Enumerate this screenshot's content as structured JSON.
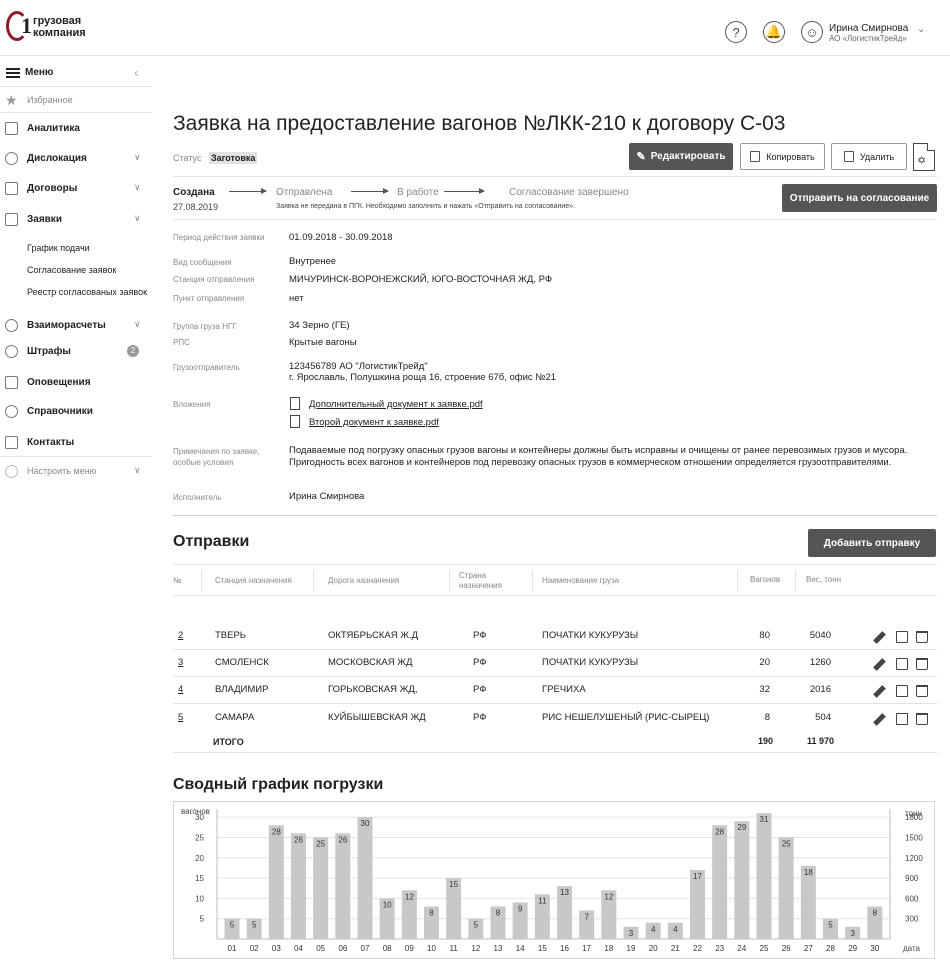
{
  "header": {
    "logo_line1": "грузовая",
    "logo_line2": "компания",
    "user_name": "Ирина Смирнова",
    "user_org": "АО «ЛогистикТрейд»"
  },
  "sidebar": {
    "menu_label": "Меню",
    "favorites": "Избранное",
    "items": [
      {
        "label": "Аналитика"
      },
      {
        "label": "Дислокация"
      },
      {
        "label": "Договоры"
      },
      {
        "label": "Заявки"
      },
      {
        "label": "Взаиморасчеты"
      },
      {
        "label": "Штрафы",
        "badge": "2"
      },
      {
        "label": "Оповещения"
      },
      {
        "label": "Справочники"
      },
      {
        "label": "Контакты"
      }
    ],
    "subitems": [
      "График подачи",
      "Согласование заявок",
      "Реестр согласованых заявок"
    ],
    "configure": "Настроить меню"
  },
  "page": {
    "title": "Заявка на предоставление вагонов №ЛКК-210 к договору С-03",
    "status_label": "Статус",
    "status_value": "Заготовка",
    "buttons": {
      "edit": "Редактировать",
      "copy": "Копировать",
      "delete": "Удалить",
      "send": "Отправить на согласование",
      "add_shipment": "Добавить отправку"
    },
    "steps": [
      "Создана",
      "Отправлена",
      "В работе",
      "Согласование завершено"
    ],
    "created_date": "27.08.2019",
    "step_note": "Заявка не передана в ПГК. Необходимо заполнить и нажать «Отправить на согласование».",
    "fields": {
      "period_label": "Период действия заявки",
      "period_value": "01.09.2018 - 30.09.2018",
      "kind_label": "Вид сообщения",
      "kind_value": "Внутренее",
      "station_label": "Станция отправления",
      "station_value": "МИЧУРИНСК-ВОРОНЕЖСКИЙ, ЮГО-ВОСТОЧНАЯ ЖД, РФ",
      "point_label": "Пункт отправления",
      "point_value": "нет",
      "cargo_label": "Группа груза  НГГ",
      "cargo_value": "34 Зерно (ГЕ)",
      "rps_label": "РПС",
      "rps_value": "Крытые вагоны",
      "shipper_label": "Грузоотправитель",
      "shipper_value1": "123456789  АО \"ЛогистикТрейд\"",
      "shipper_value2": "г. Ярославль, Полушкина роща 16, строение 67б, офис №21",
      "attach_label": "Вложения",
      "attach1": "Дополнительный документ к заявке.pdf",
      "attach2": "Второй документ к заявке.pdf",
      "notes_label1": "Примечания по заявке,",
      "notes_label2": "особые условия",
      "notes_value1": "Подаваемые под погрузку опасных грузов вагоны и контейнеры должны быть исправны и очищены от ранее перевозимых грузов и мусора.",
      "notes_value2": "Пригодность всех вагонов и контейнеров под перевозку опасных грузов в коммерческом отношении определяется грузоотправителями.",
      "executor_label": "Исполнитель",
      "executor_value": "Ирина Смирнова"
    }
  },
  "shipments": {
    "title": "Отправки",
    "headers": {
      "num": "№",
      "station": "Станция назначения",
      "road": "Дорога  назначения",
      "country1": "Страна",
      "country2": "назначения",
      "cargo": "Наименование груза",
      "wagons": "Вагонов",
      "weight": "Вес, тонн"
    },
    "rows": [
      {
        "num": "2",
        "station": "ТВЕРЬ",
        "road": "ОКТЯБРЬСКАЯ Ж.Д",
        "country": "РФ",
        "cargo": "ПОЧАТКИ КУКУРУЗЫ",
        "wagons": "80",
        "weight": "5040"
      },
      {
        "num": "3",
        "station": "СМОЛЕНСК",
        "road": "МОСКОВСКАЯ ЖД",
        "country": "РФ",
        "cargo": "ПОЧАТКИ КУКУРУЗЫ",
        "wagons": "20",
        "weight": "1260"
      },
      {
        "num": "4",
        "station": "ВЛАДИМИР",
        "road": "ГОРЬКОВСКАЯ ЖД,",
        "country": "РФ",
        "cargo": "ГРЕЧИХА",
        "wagons": "32",
        "weight": "2016"
      },
      {
        "num": "5",
        "station": "САМАРА",
        "road": "КУЙБЫШЕВСКАЯ ЖД",
        "country": "РФ",
        "cargo": "РИС НЕШЕЛУШЕНЫЙ (РИС-СЫРЕЦ)",
        "wagons": "8",
        "weight": "504"
      }
    ],
    "total_label": "ИТОГО",
    "total_wagons": "190",
    "total_weight": "11 970"
  },
  "chart_title": "Сводный график погрузки",
  "chart_data": {
    "type": "bar",
    "ylabel": "вагонов",
    "y2label": "тонн",
    "xlabel": "дата",
    "ylim": [
      0,
      32
    ],
    "yticks": [
      5,
      10,
      15,
      20,
      25,
      30
    ],
    "y2ticks": [
      300,
      600,
      900,
      1200,
      1500,
      1800
    ],
    "grid": true,
    "categories": [
      "01",
      "02",
      "03",
      "04",
      "05",
      "06",
      "07",
      "08",
      "09",
      "10",
      "11",
      "12",
      "13",
      "14",
      "15",
      "16",
      "17",
      "18",
      "19",
      "20",
      "21",
      "22",
      "23",
      "24",
      "25",
      "26",
      "27",
      "28",
      "29",
      "30"
    ],
    "values": [
      5,
      5,
      28,
      26,
      25,
      26,
      30,
      10,
      12,
      8,
      15,
      5,
      8,
      9,
      11,
      13,
      7,
      12,
      3,
      4,
      4,
      17,
      28,
      29,
      31,
      25,
      18,
      5,
      3,
      8
    ],
    "bar_color": "#c8c8c8"
  }
}
